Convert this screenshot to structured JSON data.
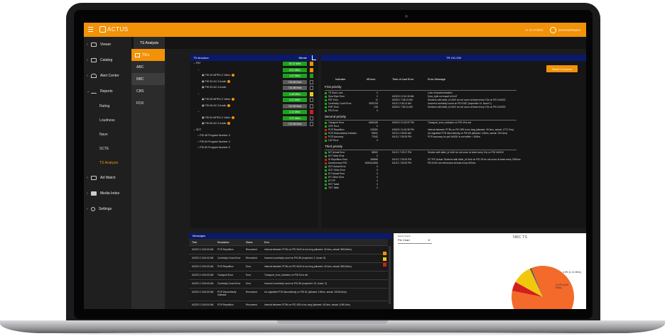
{
  "app": {
    "brand": "ACTUS",
    "top_right_text": "11 91 07/2021",
    "user": "jameswashington"
  },
  "sidebar": {
    "items": [
      {
        "label": "Viewer",
        "icon": "monitor-icon"
      },
      {
        "label": "Catalog",
        "icon": "list-icon"
      },
      {
        "label": "Alert Center",
        "icon": "bell-icon"
      },
      {
        "label": "Reports",
        "icon": "trend-icon"
      }
    ],
    "report_subitems": [
      "Rating",
      "Loudness",
      "Nave",
      "SCTE",
      "TS Analysis"
    ],
    "bottom_items": [
      {
        "label": "Ad Watch",
        "icon": "ad-icon"
      },
      {
        "label": "Media Index",
        "icon": "media-icon"
      },
      {
        "label": "Settings",
        "icon": "gear-icon"
      }
    ]
  },
  "channels": {
    "header": "TS's",
    "items": [
      "ABC",
      "NBC",
      "CBS",
      "FOX"
    ],
    "selected": "NBC"
  },
  "tabs": {
    "active": "TS Analysis"
  },
  "ts_structure": {
    "title": "TS structure",
    "rate_header": "Bitrate",
    "rows": [
      {
        "label": "PAT",
        "rate": "18.11 Mb/s",
        "rate_style": "green",
        "indent": 4,
        "arrow": "v",
        "sq": "orange"
      },
      {
        "label": "",
        "rate": "8.01 Mb/s",
        "rate_style": "green",
        "indent": 10,
        "arrow": "v",
        "sq": "orange"
      },
      {
        "label": "PID 49 MPEG-2 Video",
        "rate": "1.47 Mb/s",
        "rate_style": "green",
        "indent": 16,
        "warn": true,
        "sq": "green"
      },
      {
        "label": "PID 52 AC-3 Audio",
        "rate": "715.48 Kb/s",
        "rate_style": "gray",
        "indent": 16,
        "warn": true,
        "sq": ""
      },
      {
        "label": "PID 53 AC-3 Audio",
        "rate": "714.68 Kb/s",
        "rate_style": "gray",
        "indent": 16,
        "sq": ""
      },
      {
        "label": "",
        "rate": "6.48 Mb/s",
        "rate_style": "green",
        "indent": 10,
        "arrow": "v",
        "sq": "yellow"
      },
      {
        "label": "PID 65 MPEG-2 Video",
        "rate": "6.11 Mb/s",
        "rate_style": "green",
        "indent": 16,
        "warn": true,
        "sq": ""
      },
      {
        "label": "PID 66 AC-3 Audio",
        "rate": "711.39 Kb/s",
        "rate_style": "gray",
        "indent": 16,
        "warn": true,
        "sq": ""
      },
      {
        "label": "",
        "rate": "2.14 Mb/s",
        "rate_style": "green",
        "indent": 10,
        "arrow": "v",
        "sq": "red"
      },
      {
        "label": "PID 81 MPEG-2 Video",
        "rate": "3.37 Mb/s",
        "rate_style": "green",
        "indent": 16,
        "warn": true,
        "sq": ""
      },
      {
        "label": "PID 84 AC-3 Audio",
        "rate": "712.96 Kb/s",
        "rate_style": "gray",
        "indent": 16,
        "warn": true,
        "sq": ""
      },
      {
        "label": "SDT",
        "rate": "",
        "indent": 4,
        "arrow": "v"
      },
      {
        "label": "PID 48 Program Number 3",
        "rate": "",
        "indent": 10
      },
      {
        "label": "PID 64 Program Number 4",
        "rate": "",
        "indent": 10
      },
      {
        "label": "PID 80 Program Number 5",
        "rate": "",
        "indent": 10
      }
    ]
  },
  "tr101290": {
    "title": "TR 101 290",
    "reset_label": "Reset Counters",
    "columns": [
      "Indicator",
      "#Errors",
      "Time of Last Error",
      "Error Message"
    ],
    "priorities": [
      {
        "label": "First priority",
        "rows": [
          {
            "name": "TS Sync Loss",
            "count": "0",
            "time": "",
            "msg": "Loss of synchronization",
            "dot": "g"
          },
          {
            "name": "Sync Byte Error",
            "count": "0",
            "time": "6/22/21 12:10:15 AM",
            "msg": "Sync_byte not equal to 0x47",
            "dot": "g"
          },
          {
            "name": "PAT Error",
            "count": "11",
            "time": "6/20/21 7:08:13 AM",
            "msg": "Sections with table_id 0x00 do not occur at least every 0.5s on PID 0x0000",
            "dot": "g"
          },
          {
            "name": "Continuity Count Error",
            "count": "3002709",
            "time": "5/1/21 2:43:13 AM",
            "msg": "Incorrect continuity count on PID 8187 (expected 14, found 1)",
            "dot": "g"
          },
          {
            "name": "PMT Error",
            "count": "215",
            "time": "6/20/21 7:08:14 AM",
            "msg": "Sections with table_id 0x02 do not occur at least every 0.5s on PID 0x0030",
            "dot": "g"
          },
          {
            "name": "PID Error",
            "count": "0",
            "time": "",
            "msg": "",
            "dot": "g"
          }
        ]
      },
      {
        "label": "Second priority",
        "rows": [
          {
            "name": "Transport Error",
            "count": "6654185",
            "time": "6/20/21 10:15:37 PM",
            "msg": "Transport_error_indicator on PID 49 is set",
            "dot": "g"
          },
          {
            "name": "CRC Error",
            "count": "0",
            "time": "",
            "msg": "",
            "dot": "g"
          },
          {
            "name": "PCR Repetition",
            "count": "102081",
            "time": "6/30/21 10:15:36 PM",
            "msg": "Interval between PCRs on PID 289 is too long (allowed: 40.0ms, actual: 1772.7ms)",
            "dot": "r"
          },
          {
            "name": "PCR Discontinuity Indicator",
            "count": "92831",
            "time": "5/1/21 2:39:53 AM",
            "msg": "Un-signalled PCR discontinuity on PID 65 (allowed: 100ms, actual: 100.0ms)",
            "dot": "g"
          },
          {
            "name": "PCR Accuracy",
            "count": "77642",
            "time": "5/1/21 7:29:25 PM",
            "msg": "PCR accuracy for pid 0x0051 is not within +-500ns",
            "dot": "r"
          },
          {
            "name": "CAT Error",
            "count": "0",
            "time": "",
            "msg": "",
            "dot": "g"
          }
        ]
      },
      {
        "label": "Third priority",
        "rows": [
          {
            "name": "NIT Actual Error",
            "count": "38282",
            "time": "5/1/21 7:29:17 PM",
            "msg": "Section with table_id 0x40 do not occur at least every 10s on PID 0x0010",
            "dot": "g"
          },
          {
            "name": "NIT Other Error",
            "count": "0",
            "time": "",
            "msg": "",
            "dot": "g"
          },
          {
            "name": "SI Repetition Error",
            "count": "305966",
            "time": "5/1/21 7:29:25 PM",
            "msg": "SIT P/F Actual: Sections with table_id 0x4e on PID 18 do not occur at least every 2000ms",
            "dot": "r"
          },
          {
            "name": "Unreferenced PID",
            "count": "3009412506",
            "time": "5/1/21 7:29:25 PM",
            "msg": "PID 8192 not referenced at least every 500ms",
            "dot": "r"
          },
          {
            "name": "SDT Actual Error",
            "count": "0",
            "time": "",
            "msg": "",
            "dot": "g"
          },
          {
            "name": "SDT Other Error",
            "count": "0",
            "time": "",
            "msg": "",
            "dot": "g"
          },
          {
            "name": "EIT Actual Error",
            "count": "0",
            "time": "",
            "msg": "",
            "dot": "g"
          },
          {
            "name": "EIT Other Error",
            "count": "0",
            "time": "",
            "msg": "",
            "dot": "g"
          },
          {
            "name": "EIT PF",
            "count": "0",
            "time": "",
            "msg": "",
            "dot": "g"
          },
          {
            "name": "RST Table",
            "count": "0",
            "time": "",
            "msg": "",
            "dot": "g"
          },
          {
            "name": "TDT Table",
            "count": "0",
            "time": "",
            "msg": "",
            "dot": "g"
          }
        ]
      }
    ]
  },
  "messages": {
    "title": "Messages",
    "columns": [
      "Time",
      "Description",
      "Status",
      "Error"
    ],
    "rows": [
      [
        "6/22/21 12:54:00 AM",
        "PCR Repetition",
        "Recovered",
        "Interval between PCRs on PID 8143 is too long (allowed: 40.0ms, actual: 9818.8ms)"
      ],
      [
        "6/22/21 12:54:00 AM",
        "Continuity Count Error",
        "Recovered",
        "Incorrect continuity count on PID 65 (expected: 2, found: 5)"
      ],
      [
        "6/22/21 12:54:00 AM",
        "PCR Repetition",
        "Error",
        "Interval between PCRs on PID 8143 is too long (allowed: 40.0ms, actual: 9818.8ms)"
      ],
      [
        "6/22/21 12:54:00 AM",
        "Transport Error",
        "Error",
        "Transport_error_indicator on PID 54 is set"
      ],
      [
        "6/22/21 12:54:00 AM",
        "Continuity Count Error",
        "Error",
        "Incorrect continuity count on PID 65 (expected: 13, found: 0)"
      ],
      [
        "6/22/21 12:54:00 AM",
        "PCR Discontinuity Indicator",
        "Recovered",
        "Un-signalled PCR discontinuity on PID 81 (allowed: 100ms, actual: 19150.8ms)"
      ],
      [
        "6/22/21 12:54:00 AM",
        "PCR Repetition",
        "Recovered",
        "Interval between PCRs on PID 305 is too long (allowed: 40.0ms, actual: 1196.2ms)"
      ]
    ]
  },
  "chart_panel": {
    "select_label": "Select Graph",
    "select_value": "Pie Chart",
    "title": "NBC TS"
  },
  "chart_data": {
    "type": "pie",
    "title": "NBC TS",
    "slices": [
      {
        "label": "",
        "value": 84.2,
        "color": "#f36a2a"
      },
      {
        "label": "4.8% (1.14 Mb/s)",
        "value": 4.8,
        "color": "#d21e1e"
      },
      {
        "label": "10.2% (6.00 Mb/s)",
        "value": 10.2,
        "color": "#f2c80f"
      },
      {
        "label": "",
        "value": 0.8,
        "color": "#555555"
      }
    ]
  },
  "colors": {
    "accent": "#f29208",
    "panel_header": "#0a1a6a",
    "ok": "#1fa11f",
    "error": "#d21e1e"
  }
}
